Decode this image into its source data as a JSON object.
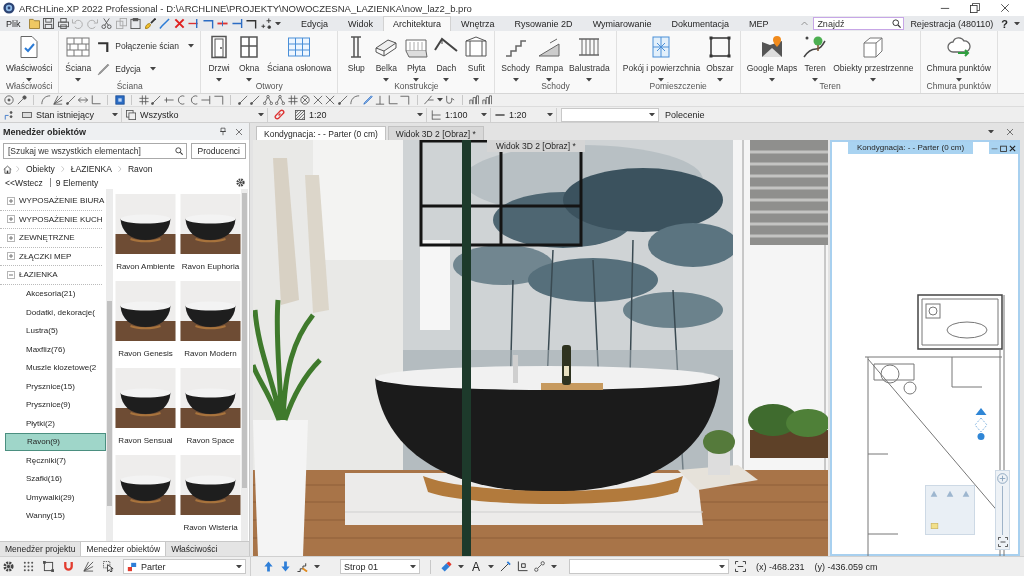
{
  "window": {
    "title": "ARCHLine.XP 2022 Professional - D:\\ARCHLINE\\PROJEKTY\\NOWOCZESNA_LAZIENKA\\now_laz2_b.pro"
  },
  "menu": {
    "file": "Plik",
    "tabs": [
      {
        "label": "Edycja",
        "selected": false
      },
      {
        "label": "Widok",
        "selected": false
      },
      {
        "label": "Architektura",
        "selected": true
      },
      {
        "label": "Wnętrza",
        "selected": false
      },
      {
        "label": "Rysowanie 2D",
        "selected": false
      },
      {
        "label": "Wymiarowanie",
        "selected": false
      },
      {
        "label": "Dokumentacja",
        "selected": false
      },
      {
        "label": "MEP",
        "selected": false
      }
    ],
    "search": {
      "placeholder": "Znajdź"
    },
    "registration": "Rejestracja (480110)",
    "help": "?"
  },
  "ribbon": {
    "groups": [
      {
        "title": "Właściwości",
        "tools": [
          {
            "label": "Właściwości",
            "kind": "large",
            "dropdown": true
          }
        ]
      },
      {
        "title": "Ściana",
        "tools": [
          {
            "label": "Ściana",
            "kind": "large",
            "dropdown": true
          },
          {
            "label": "Połączenie ścian",
            "kind": "small",
            "dropdown": true
          },
          {
            "label": "Edycja",
            "kind": "small",
            "dropdown": true
          }
        ]
      },
      {
        "title": "Otwory",
        "tools": [
          {
            "label": "Drzwi",
            "kind": "large",
            "dropdown": true
          },
          {
            "label": "Okna",
            "kind": "large",
            "dropdown": true
          },
          {
            "label": "Ściana osłonowa",
            "kind": "large",
            "dropdown": false
          }
        ]
      },
      {
        "title": "Konstrukcje",
        "tools": [
          {
            "label": "Słup",
            "kind": "large",
            "dropdown": false
          },
          {
            "label": "Belka",
            "kind": "large",
            "dropdown": true
          },
          {
            "label": "Płyta",
            "kind": "large",
            "dropdown": true
          },
          {
            "label": "Dach",
            "kind": "large",
            "dropdown": true
          },
          {
            "label": "Sufit",
            "kind": "large",
            "dropdown": true
          }
        ]
      },
      {
        "title": "Schody",
        "tools": [
          {
            "label": "Schody",
            "kind": "large",
            "dropdown": true
          },
          {
            "label": "Rampa",
            "kind": "large",
            "dropdown": true
          },
          {
            "label": "Balustrada",
            "kind": "large",
            "dropdown": true
          }
        ]
      },
      {
        "title": "Pomieszczenie",
        "tools": [
          {
            "label": "Pokój i powierzchnia",
            "kind": "large",
            "dropdown": true
          },
          {
            "label": "Obszar",
            "kind": "large",
            "dropdown": true
          }
        ]
      },
      {
        "title": "Teren",
        "tools": [
          {
            "label": "Google Maps",
            "kind": "large",
            "dropdown": true
          },
          {
            "label": "Teren",
            "kind": "large",
            "dropdown": true
          },
          {
            "label": "Obiekty przestrzenne",
            "kind": "large",
            "dropdown": true
          }
        ]
      },
      {
        "title": "Chmura punktów",
        "tools": [
          {
            "label": "Chmura punktów",
            "kind": "large",
            "dropdown": true
          }
        ]
      }
    ]
  },
  "properties_bar": {
    "phase": "Stan istniejący",
    "layer": "Wszystko",
    "hatch_scale": "1:20",
    "scale": "1:100",
    "line_scale": "1:20",
    "command_label": "Polecenie"
  },
  "object_manager": {
    "title": "Menedżer obiektów",
    "search": {
      "placeholder": "[Szukaj we wszystkich elementach]"
    },
    "producers_button": "Producenci",
    "breadcrumb": [
      "Obiekty",
      "ŁAZIENKA",
      "Ravon"
    ],
    "back_link": "<<Wstecz",
    "count": "9 Elementy",
    "tree": [
      {
        "label": "WYPOSAŻENIE BIURA",
        "expanded": false,
        "selected": false
      },
      {
        "label": "WYPOSAŻENIE KUCH",
        "expanded": false,
        "selected": false
      },
      {
        "label": "ZEWNĘTRZNE",
        "expanded": false,
        "selected": false
      },
      {
        "label": "ZŁĄCZKI MEP",
        "expanded": false,
        "selected": false
      },
      {
        "label": "ŁAZIENKA",
        "expanded": true,
        "selected": false,
        "children": [
          {
            "label": "Akcesoria(21)",
            "selected": false
          },
          {
            "label": "Dodatki, dekoracje(",
            "selected": false
          },
          {
            "label": "Lustra(5)",
            "selected": false
          },
          {
            "label": "Maxfliz(76)",
            "selected": false
          },
          {
            "label": "Muszle klozetowe(2",
            "selected": false
          },
          {
            "label": "Prysznice(15)",
            "selected": false
          },
          {
            "label": "Prysznice(9)",
            "selected": false
          },
          {
            "label": "Płytki(2)",
            "selected": false
          },
          {
            "label": "Ravon(9)",
            "selected": true
          },
          {
            "label": "Ręczniki(7)",
            "selected": false
          },
          {
            "label": "Szafki(16)",
            "selected": false
          },
          {
            "label": "Umywalki(29)",
            "selected": false
          },
          {
            "label": "Wanny(15)",
            "selected": false
          }
        ]
      }
    ],
    "items": [
      {
        "kind": "captioned",
        "name": "Ravon Ambiente"
      },
      {
        "kind": "captioned",
        "name": "Ravon Euphoria"
      },
      {
        "kind": "captioned",
        "name": "Ravon Genesis"
      },
      {
        "kind": "captioned",
        "name": "Ravon Modern"
      },
      {
        "kind": "captioned",
        "name": "Ravon Sensual"
      },
      {
        "kind": "captioned",
        "name": "Ravon Space"
      },
      {
        "kind": "uncaptioned"
      },
      {
        "kind": "captioned",
        "name": "Ravon Wisteria"
      }
    ],
    "tabs": [
      {
        "label": "Menedżer projektu",
        "selected": false
      },
      {
        "label": "Menedżer obiektów",
        "selected": true
      },
      {
        "label": "Właściwości",
        "selected": false
      }
    ]
  },
  "view": {
    "tabs": [
      {
        "label": "Kondygnacja: - - Parter (0 cm)",
        "selected": true
      },
      {
        "label": "Widok 3D 2 [Obraz] *",
        "selected": false
      }
    ],
    "render_title": "Widok 3D 2 [Obraz] *",
    "plan_window": {
      "title": "Kondygnacja: - - Parter (0 cm)"
    }
  },
  "status_bar": {
    "storey": "Parter",
    "slab": "Strop 01",
    "text_tool": "A",
    "x": "(x) -468.231",
    "y": "(y) -436.059 cm"
  }
}
